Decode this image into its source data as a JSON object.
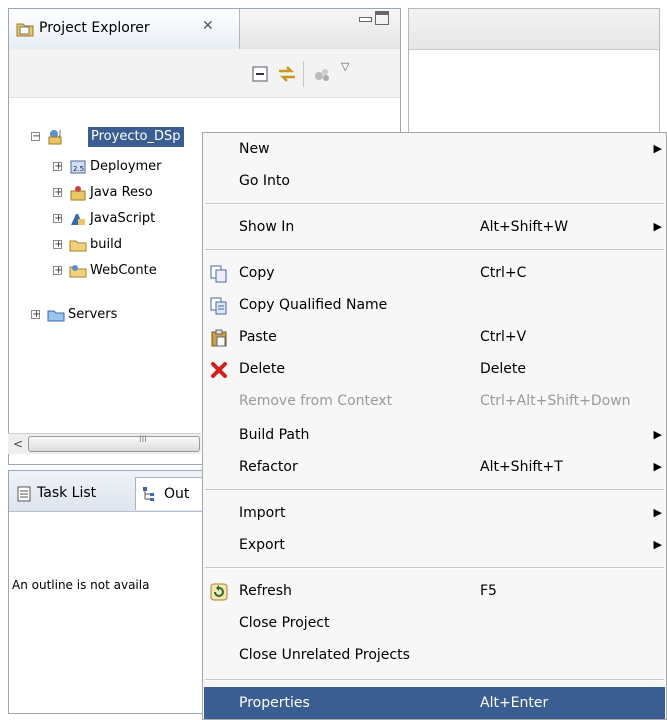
{
  "explorer": {
    "title": "Project Explorer",
    "close_glyph": "✕",
    "tree": [
      {
        "label": "Proyecto_DSp",
        "icon": "web-project-icon",
        "selected": true
      },
      {
        "label": "Deploymer",
        "icon": "deployment-descriptor-icon"
      },
      {
        "label": "Java Reso",
        "icon": "java-resources-icon"
      },
      {
        "label": "JavaScript",
        "icon": "javascript-resources-icon"
      },
      {
        "label": "build",
        "icon": "folder-icon"
      },
      {
        "label": "WebConte",
        "icon": "webcontent-folder-icon"
      },
      {
        "label": "Servers",
        "icon": "folder-icon"
      }
    ],
    "scroll_glyph": "<",
    "scroll_thumb_grip": "III"
  },
  "bottom_panel": {
    "tabs": [
      {
        "label": "Task List",
        "icon": "task-list-icon"
      },
      {
        "label": "Out",
        "icon": "outline-icon"
      }
    ],
    "notice": "An outline is not availa"
  },
  "context_menu": {
    "items": [
      {
        "label": "New",
        "shortcut": "",
        "submenu": true
      },
      {
        "label": "Go Into",
        "shortcut": ""
      },
      {
        "label": "Show In",
        "shortcut": "Alt+Shift+W",
        "submenu": true
      },
      {
        "label": "Copy",
        "shortcut": "Ctrl+C",
        "icon": "copy-icon"
      },
      {
        "label": "Copy Qualified Name",
        "shortcut": "",
        "icon": "copy-qualified-name-icon"
      },
      {
        "label": "Paste",
        "shortcut": "Ctrl+V",
        "icon": "paste-icon"
      },
      {
        "label": "Delete",
        "shortcut": "Delete",
        "icon": "delete-icon"
      },
      {
        "label": "Remove from Context",
        "shortcut": "Ctrl+Alt+Shift+Down",
        "disabled": true
      },
      {
        "label": "Build Path",
        "shortcut": "",
        "submenu": true
      },
      {
        "label": "Refactor",
        "shortcut": "Alt+Shift+T",
        "submenu": true
      },
      {
        "label": "Import",
        "shortcut": "",
        "submenu": true
      },
      {
        "label": "Export",
        "shortcut": "",
        "submenu": true
      },
      {
        "label": "Refresh",
        "shortcut": "F5",
        "icon": "refresh-icon"
      },
      {
        "label": "Close Project",
        "shortcut": ""
      },
      {
        "label": "Close Unrelated Projects",
        "shortcut": ""
      },
      {
        "label": "Properties",
        "shortcut": "Alt+Enter",
        "selected": true
      }
    ],
    "submenu_glyph": "▶"
  },
  "colors": {
    "selection": "#3a5e92",
    "menu_bg": "#f7f7f7"
  }
}
